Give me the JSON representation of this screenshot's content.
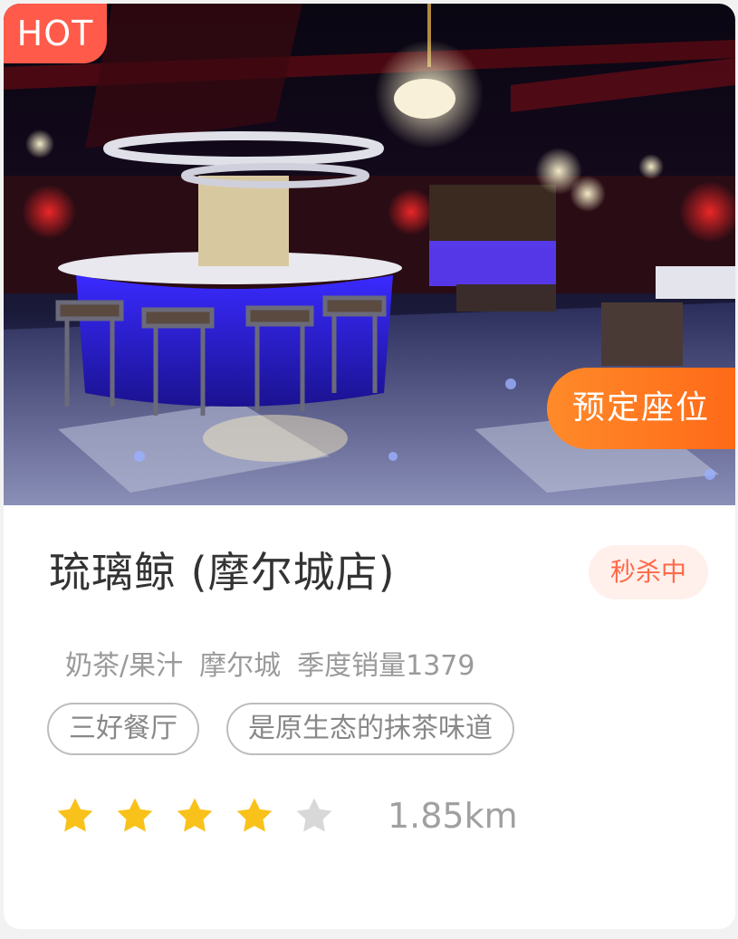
{
  "badge": {
    "hot_label": "HOT"
  },
  "cta": {
    "reserve_label": "预定座位"
  },
  "store": {
    "name": "琉璃鲸 (摩尔城店)",
    "promo_badge": "秒杀中",
    "category": "奶茶/果汁",
    "area": "摩尔城",
    "sales": "季度销量1379",
    "tags": [
      "三好餐厅",
      "是原生态的抹茶味道"
    ],
    "rating": {
      "stars_filled": 4,
      "stars_total": 5
    },
    "distance": "1.85km"
  },
  "colors": {
    "hot_badge": "#ff5a4a",
    "cta": "#ff7a20",
    "star_on": "#f9c21a",
    "star_off": "#d8d8d8",
    "promo_text": "#ff6a48"
  },
  "icons": {
    "star": "star-icon",
    "photo": "bar-interior-photo"
  }
}
